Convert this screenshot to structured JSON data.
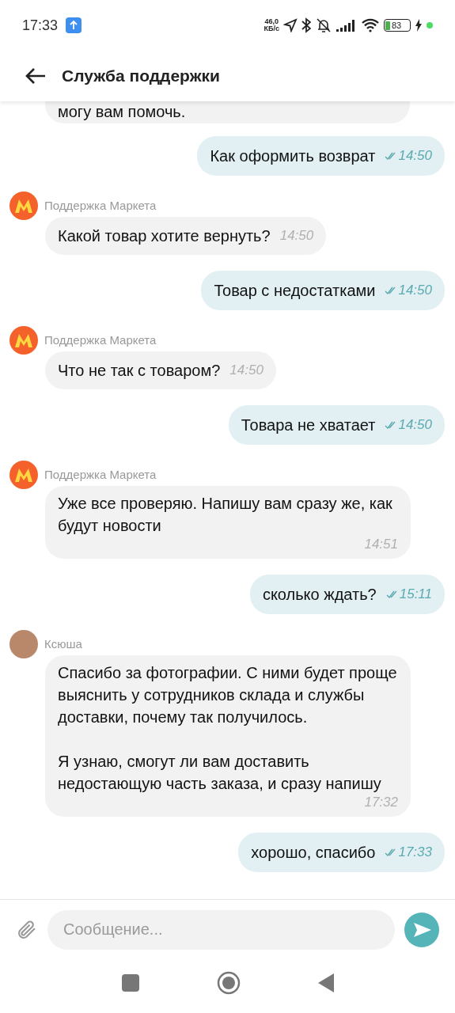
{
  "status_bar": {
    "time": "17:33",
    "speed_value": "46,0",
    "speed_unit": "КБ/с",
    "battery": "83"
  },
  "header": {
    "title": "Служба поддержки"
  },
  "messages": [
    {
      "kind": "incoming_clipped",
      "text": "могу вам помочь."
    },
    {
      "kind": "outgoing",
      "text": "Как оформить возврат",
      "time": "14:50"
    },
    {
      "kind": "incoming",
      "sender": "Поддержка Маркета",
      "avatar": {
        "kind": "logo"
      },
      "text": "Какой товар хотите вернуть?",
      "time": "14:50"
    },
    {
      "kind": "outgoing",
      "text": "Товар с недостатками",
      "time": "14:50"
    },
    {
      "kind": "incoming",
      "sender": "Поддержка Маркета",
      "avatar": {
        "kind": "logo"
      },
      "text": "Что не так с товаром?",
      "time": "14:50"
    },
    {
      "kind": "outgoing",
      "text": "Товара не хватает",
      "time": "14:50"
    },
    {
      "kind": "incoming",
      "sender": "Поддержка Маркета",
      "avatar": {
        "kind": "logo"
      },
      "text": "Уже все проверяю. Напишу вам сразу же, как будут новости",
      "time": "14:51"
    },
    {
      "kind": "outgoing",
      "text": "сколько ждать?",
      "time": "15:11"
    },
    {
      "kind": "incoming",
      "sender": "Ксюша",
      "avatar": {
        "kind": "photo"
      },
      "text": "Спасибо за фотографии. С ними будет проще выяснить у сотрудников склада и службы доставки, почему так получилось.\n\nЯ узнаю, смогут ли вам доставить недостающую часть заказа, и сразу напишу",
      "time": "17:32"
    },
    {
      "kind": "outgoing",
      "text": "хорошо, спасибо",
      "time": "17:33"
    }
  ],
  "composer": {
    "placeholder": "Сообщение..."
  }
}
